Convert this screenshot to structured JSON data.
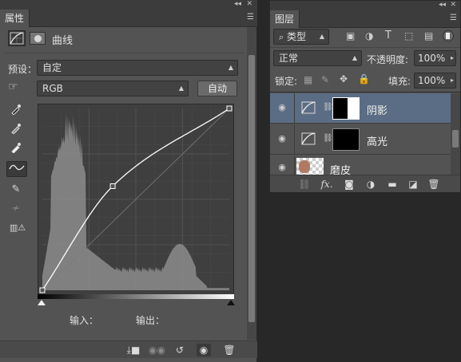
{
  "properties_panel": {
    "tab_label": "属性",
    "section_title": "曲线",
    "preset_label": "预设：",
    "preset_value": "自定",
    "channel_value": "RGB",
    "auto_button": "自动",
    "input_label": "输入：",
    "output_label": "输出："
  },
  "layers_panel": {
    "tab_label": "图层",
    "filter_label": "类型",
    "blend_mode": "正常",
    "opacity_label": "不透明度:",
    "opacity_value": "100%",
    "lock_label": "锁定:",
    "fill_label": "填充:",
    "fill_value": "100%",
    "layers": [
      {
        "name": "阴影",
        "selected": true
      },
      {
        "name": "高光",
        "selected": false
      },
      {
        "name": "磨皮",
        "selected": false
      }
    ],
    "footer_fx": "fx."
  },
  "chart_data": {
    "type": "line",
    "title": "",
    "xlabel": "",
    "ylabel": "",
    "xlim": [
      0,
      255
    ],
    "ylim": [
      0,
      255
    ],
    "series": [
      {
        "x": [
          0,
          96,
          255
        ],
        "values": [
          0,
          146,
          255
        ]
      }
    ]
  }
}
